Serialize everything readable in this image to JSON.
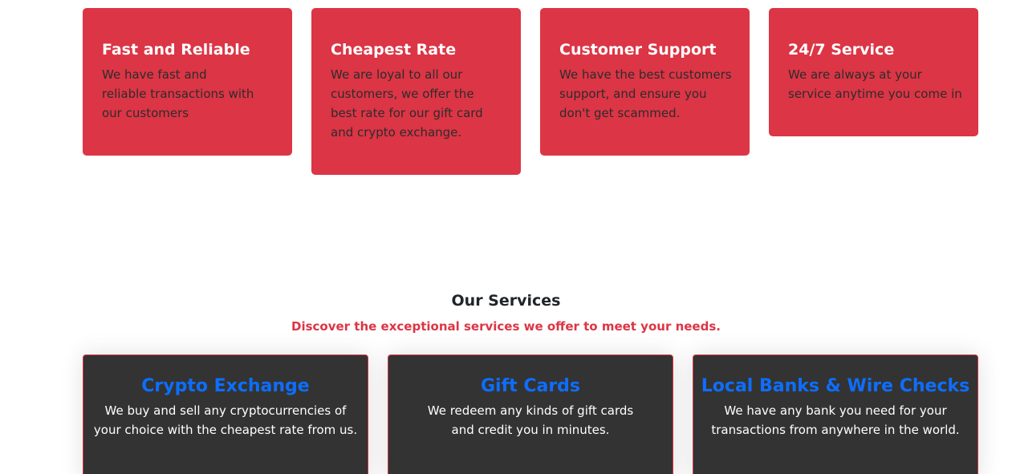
{
  "features": [
    {
      "title": "Fast and Reliable",
      "text": "We have fast and reliable transactions with our customers"
    },
    {
      "title": "Cheapest Rate",
      "text": "We are loyal to all our customers, we offer the best rate for our gift card and crypto exchange."
    },
    {
      "title": "Customer Support",
      "text": "We have the best customers support, and ensure you don't get scammed."
    },
    {
      "title": "24/7 Service",
      "text": "We are always at your service anytime you come in"
    }
  ],
  "services_section": {
    "heading": "Our Services",
    "subheading": "Discover the exceptional services we offer to meet your needs."
  },
  "services": [
    {
      "title": "Crypto Exchange",
      "text": "We buy and sell any cryptocurrencies of your choice with the cheapest rate from us."
    },
    {
      "title": "Gift Cards",
      "text": "We redeem any kinds of gift cards and credit you in minutes."
    },
    {
      "title": "Local Banks & Wire Checks",
      "text": "We have any bank you need for your transactions from anywhere in the world."
    }
  ],
  "colors": {
    "feature_card_bg": "#dc3545",
    "service_card_bg": "#333333",
    "service_title": "#0d6efd",
    "subheading": "#dc3545"
  }
}
